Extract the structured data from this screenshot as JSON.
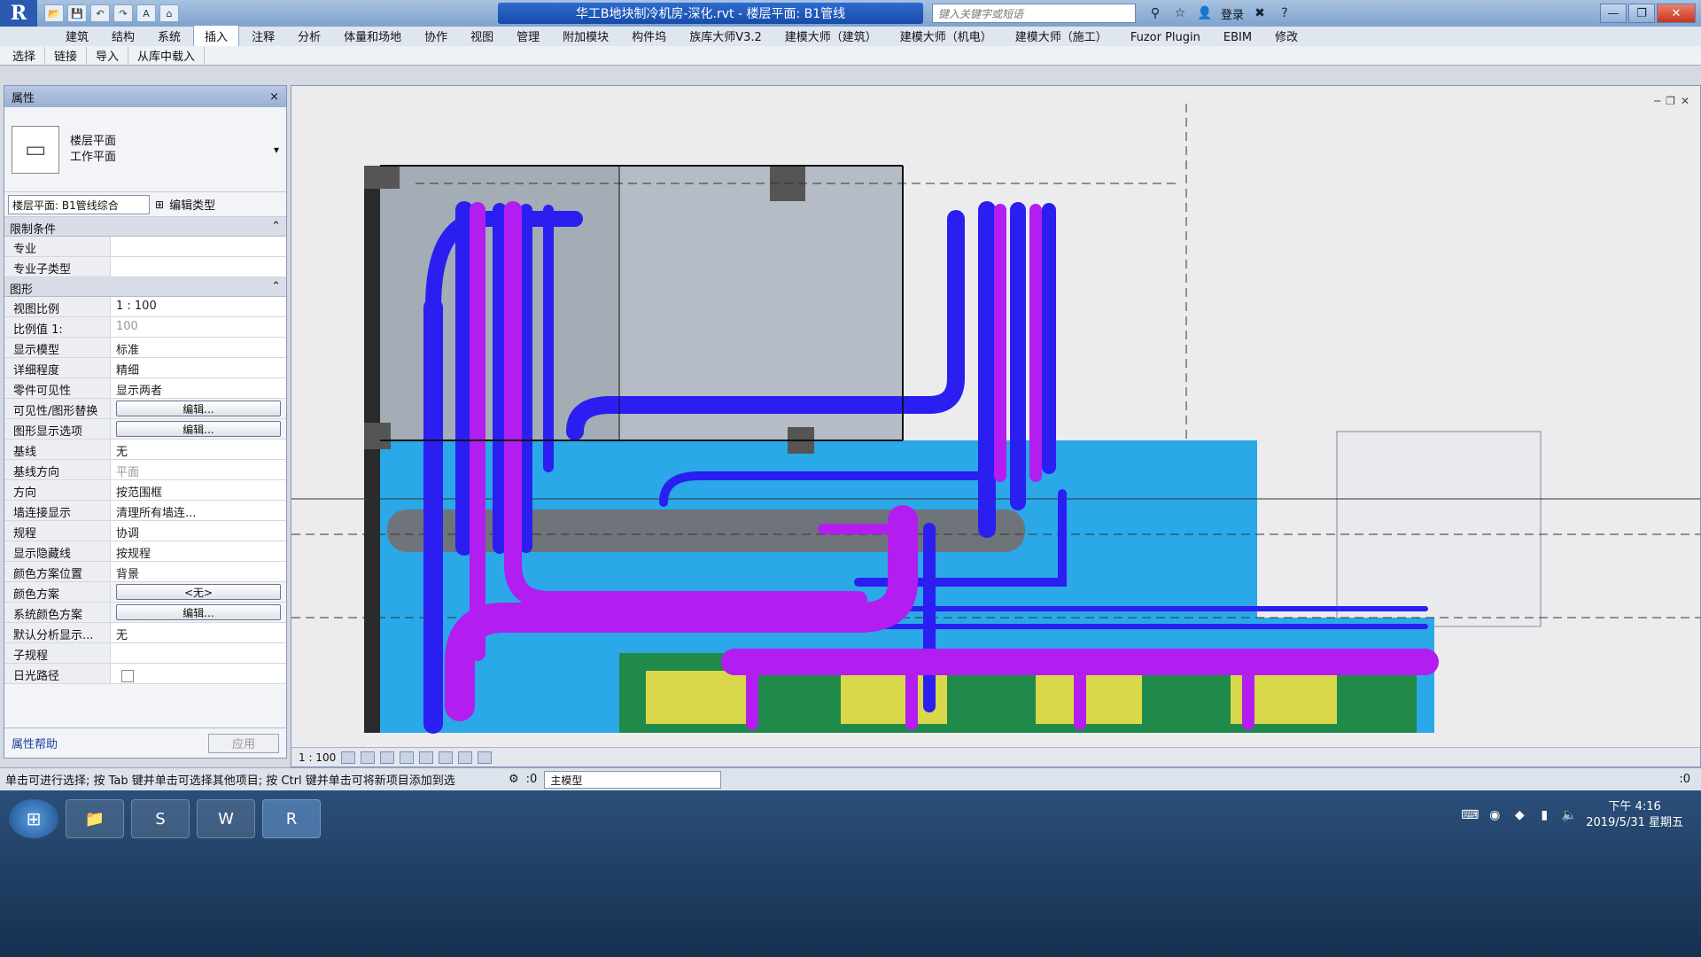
{
  "app": {
    "logo": "R",
    "doc_title": "华工B地块制冷机房-深化.rvt - 楼层平面: B1管线",
    "search_placeholder": "键入关键字或短语",
    "login": "登录",
    "qat": [
      "📂",
      "💾",
      "↶",
      "↷",
      "A",
      "⌂"
    ],
    "win_buttons": {
      "minimize": "—",
      "restore": "❐",
      "close": "✕"
    }
  },
  "ribbon": {
    "tabs": [
      "建筑",
      "结构",
      "系统",
      "插入",
      "注释",
      "分析",
      "体量和场地",
      "协作",
      "视图",
      "管理",
      "附加模块",
      "构件坞",
      "族库大师V3.2",
      "建模大师（建筑）",
      "建模大师（机电）",
      "建模大师（施工）",
      "Fuzor Plugin",
      "EBIM",
      "修改"
    ],
    "active_tab": "插入",
    "panels": [
      "选择",
      "链接",
      "导入",
      "从库中载入"
    ]
  },
  "properties": {
    "header": "属性",
    "close": "×",
    "type_line1": "楼层平面",
    "type_line2": "工作平面",
    "instance": "楼层平面: B1管线综合",
    "edit_type": "编辑类型",
    "section_constraints": "限制条件",
    "section_graphics": "图形",
    "rows": [
      {
        "k": "专业",
        "v": ""
      },
      {
        "k": "专业子类型",
        "v": ""
      },
      {
        "k": "视图比例",
        "v": "1 : 100"
      },
      {
        "k": "比例值 1:",
        "v": "100"
      },
      {
        "k": "显示模型",
        "v": "标准"
      },
      {
        "k": "详细程度",
        "v": "精细"
      },
      {
        "k": "零件可见性",
        "v": "显示两者"
      },
      {
        "k": "可见性/图形替换",
        "v": "编辑..."
      },
      {
        "k": "图形显示选项",
        "v": "编辑..."
      },
      {
        "k": "基线",
        "v": "无"
      },
      {
        "k": "基线方向",
        "v": "平面"
      },
      {
        "k": "方向",
        "v": "按范围框"
      },
      {
        "k": "墙连接显示",
        "v": "清理所有墙连..."
      },
      {
        "k": "规程",
        "v": "协调"
      },
      {
        "k": "显示隐藏线",
        "v": "按规程"
      },
      {
        "k": "颜色方案位置",
        "v": "背景"
      },
      {
        "k": "颜色方案",
        "v": "<无>"
      },
      {
        "k": "系统颜色方案",
        "v": "编辑..."
      },
      {
        "k": "默认分析显示...",
        "v": "无"
      },
      {
        "k": "子规程",
        "v": ""
      },
      {
        "k": "日光路径",
        "v": ""
      }
    ],
    "help": "属性帮助",
    "apply": "应用"
  },
  "view": {
    "scale": "1 : 100",
    "controls": [
      "─",
      "❐",
      "✕"
    ]
  },
  "status": {
    "message": "单击可进行选择; 按 Tab 键并单击可选择其他项目; 按 Ctrl 键并单击可将新项目添加到选",
    "count": ":0",
    "model": "主模型",
    "filter": ":0"
  },
  "taskbar": {
    "clock_time": "下午 4:16",
    "clock_date": "2019/5/31 星期五"
  },
  "colors": {
    "pipe_blue": "#2a1ff0",
    "pipe_magenta": "#b21ef0",
    "water": "#2aa8e8",
    "green": "#1f8a4a"
  }
}
